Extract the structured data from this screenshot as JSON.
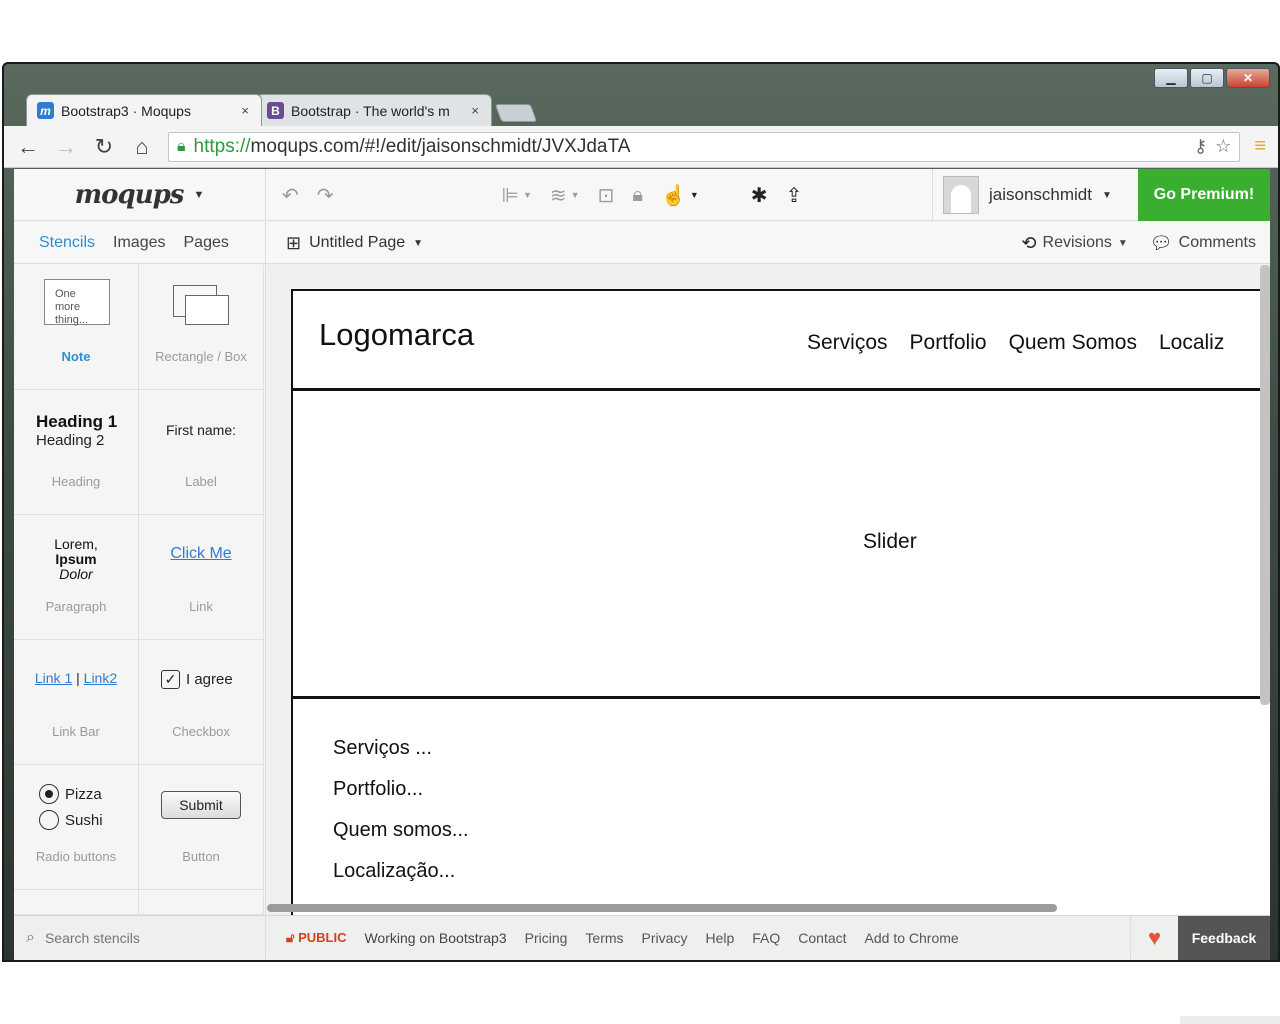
{
  "browser": {
    "tabs": [
      {
        "favicon": "m",
        "favicon_color": "#2e7cd6",
        "title": "Bootstrap3 · Moqups",
        "close": "×"
      },
      {
        "favicon": "B",
        "favicon_color": "#6a4c94",
        "title": "Bootstrap · The world's m",
        "close": "×"
      }
    ],
    "url_scheme": "https://",
    "url_rest": "moqups.com/#!/edit/jaisonschmidt/JVXJdaTA"
  },
  "app": {
    "brand": "moqups",
    "user_name": "jaisonschmidt",
    "go_premium": "Go Premium!",
    "panel_tabs": [
      "Stencils",
      "Images",
      "Pages"
    ],
    "page_name": "Untitled Page",
    "revisions": "Revisions",
    "comments": "Comments"
  },
  "stencils": {
    "note_text": "One more thing...",
    "note": "Note",
    "rectangle": "Rectangle / Box",
    "heading1": "Heading 1",
    "heading2": "Heading 2",
    "heading": "Heading",
    "label_sample": "First name:",
    "label": "Label",
    "para_line1": "Lorem,",
    "para_line2": "Ipsum",
    "para_line3": "Dolor",
    "paragraph": "Paragraph",
    "link_sample": "Click Me",
    "link": "Link",
    "link1": "Link 1",
    "link_sep": "|",
    "link2": "Link2",
    "link_bar": "Link Bar",
    "agree": "I agree",
    "checkbox": "Checkbox",
    "radio1": "Pizza",
    "radio2": "Sushi",
    "radio_buttons": "Radio buttons",
    "submit": "Submit",
    "button": "Button"
  },
  "mockup": {
    "logo": "Logomarca",
    "menu": [
      "Serviços",
      "Portfolio",
      "Quem Somos",
      "Localiz"
    ],
    "slider": "Slider",
    "list": [
      "Serviços ...",
      "Portfolio...",
      "Quem somos...",
      "Localização..."
    ]
  },
  "footer": {
    "search_placeholder": "Search stencils",
    "public": "PUBLIC",
    "working_on": "Working on",
    "project": "Bootstrap3",
    "links": [
      "Pricing",
      "Terms",
      "Privacy",
      "Help",
      "FAQ",
      "Contact",
      "Add to Chrome"
    ],
    "feedback": "Feedback"
  }
}
